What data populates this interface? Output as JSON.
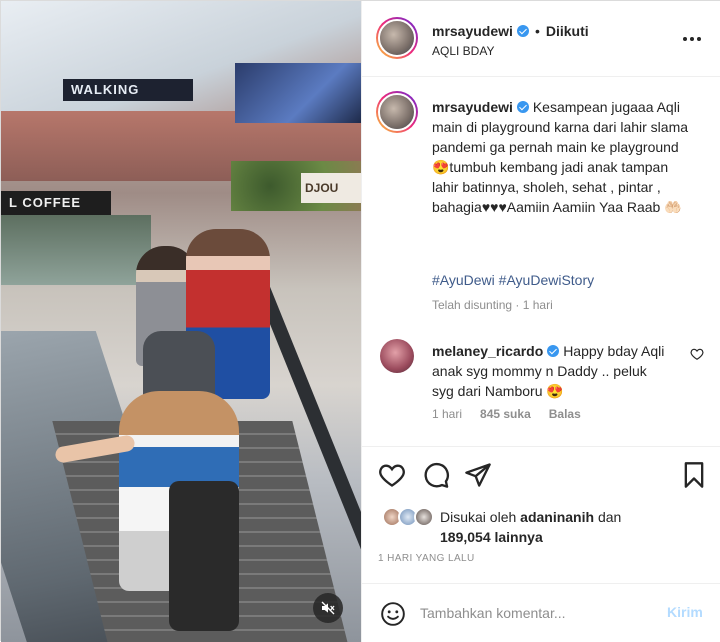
{
  "media": {
    "shop_sign": "WALKING",
    "coffee_sign": "L COFFEE",
    "cafe_sign": "DJOU",
    "mute_icon": "speaker-muted-icon"
  },
  "header": {
    "username": "mrsayudewi",
    "separator": "•",
    "follow_status": "Diikuti",
    "location": "AQLI BDAY",
    "more_icon": "more-horizontal-icon"
  },
  "caption": {
    "username": "mrsayudewi",
    "text": "Kesampean jugaaa Aqli main di playground karna dari lahir slama pandemi ga pernah main ke playground 😍tumbuh kembang jadi anak tampan lahir batinnya, sholeh, sehat , pintar , bahagia♥♥♥Aamiin Aamiin Yaa Raab 🤲🏻",
    "hashtags": [
      "#AyuDewi",
      "#AyuDewiStory"
    ],
    "edited": "Telah disunting · 1 hari"
  },
  "comment": {
    "username": "melaney_ricardo",
    "text": "Happy bday Aqli anak syg mommy n Daddy .. peluk syg dari Namboru 😍",
    "time": "1 hari",
    "likes": "845 suka",
    "reply": "Balas"
  },
  "actions": {
    "like_icon": "heart-icon",
    "comment_icon": "comment-icon",
    "share_icon": "paper-plane-icon",
    "save_icon": "bookmark-icon"
  },
  "likes": {
    "prefix": "Disukai oleh",
    "liker": "adaninanih",
    "connector": "dan",
    "count": "189,054 lainnya"
  },
  "time_ago": "1 HARI YANG LALU",
  "comment_box": {
    "placeholder": "Tambahkan komentar...",
    "post_label": "Kirim",
    "emoji_icon": "smiley-icon"
  },
  "colors": {
    "verified": "#3897f0",
    "hashtag": "#3f5b8a",
    "post_button": "#b3dbff",
    "muted_text": "#8e8e8e"
  }
}
